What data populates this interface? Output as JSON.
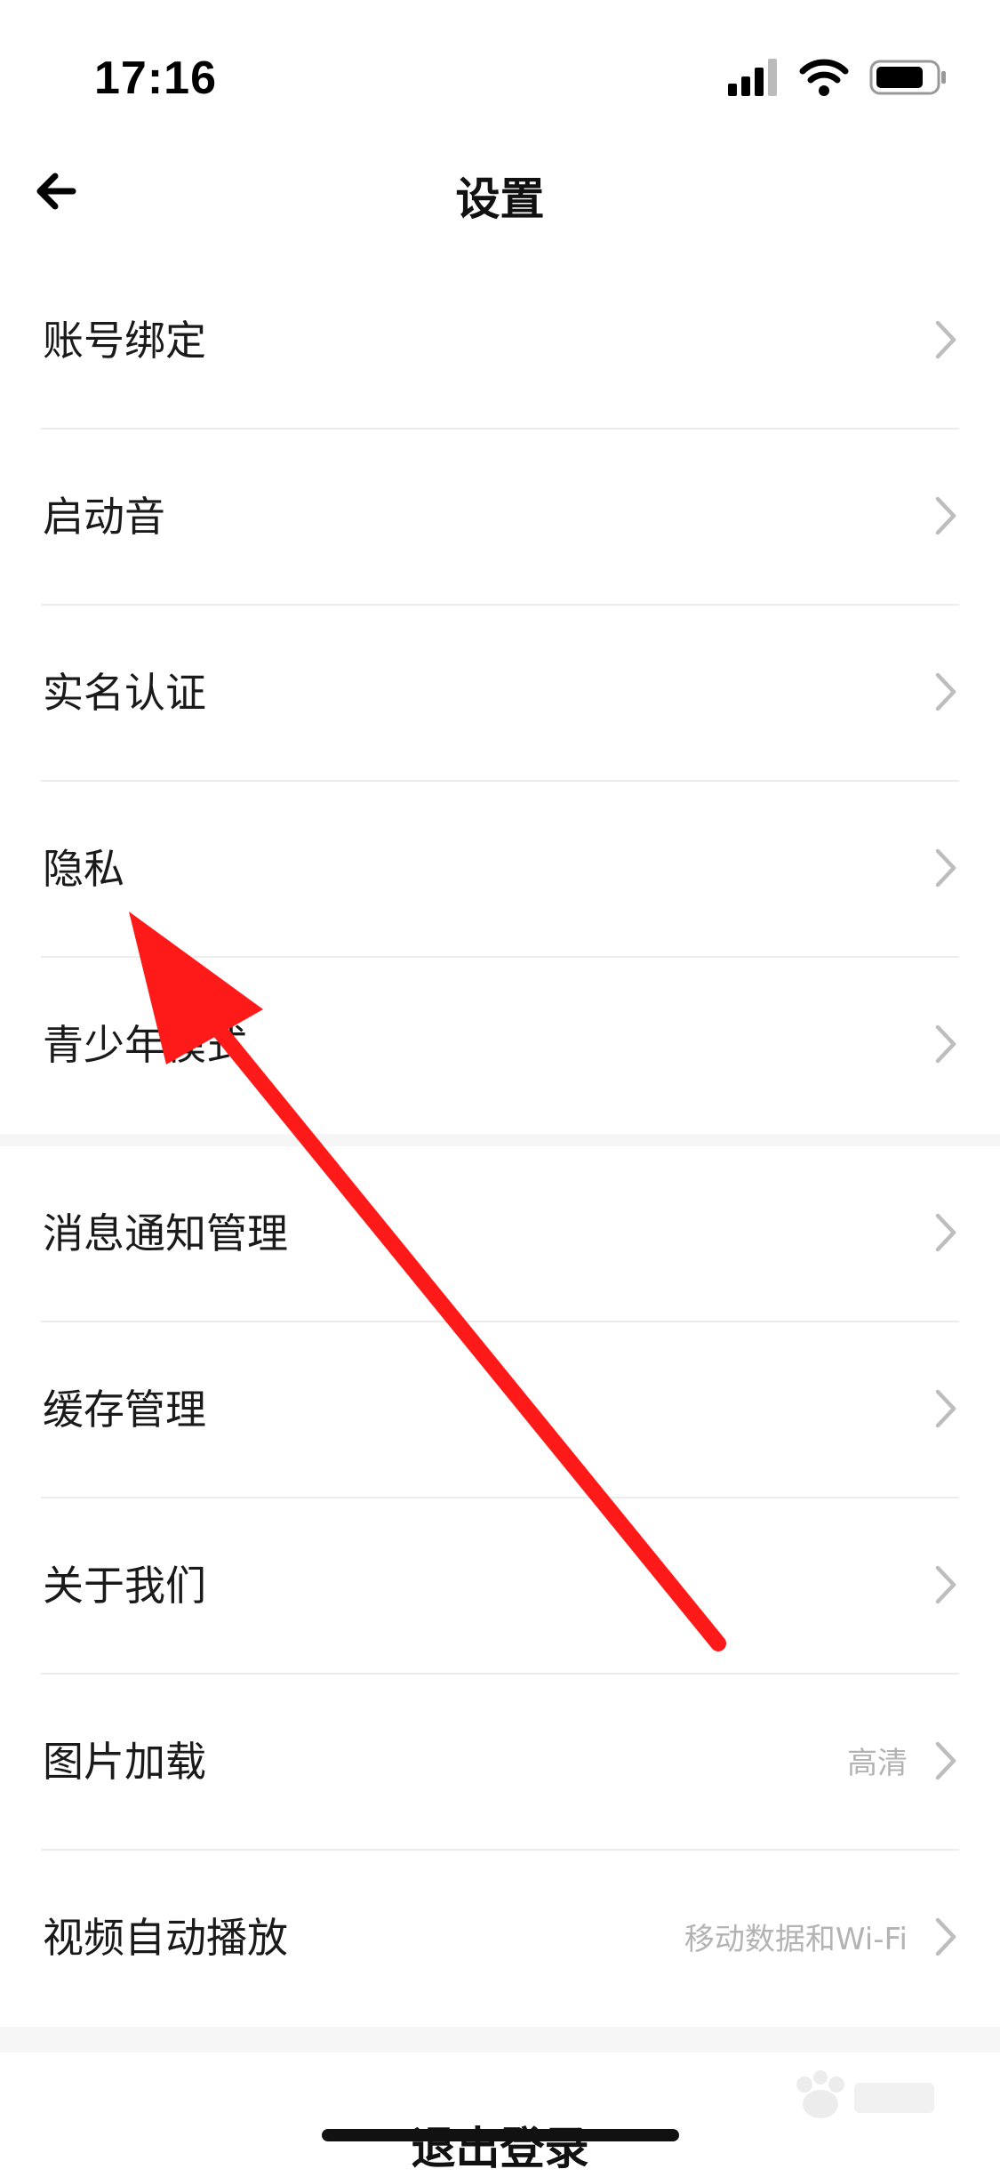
{
  "status_bar": {
    "time": "17:16"
  },
  "header": {
    "title": "设置",
    "back_icon": "arrow-left-icon"
  },
  "group1": [
    {
      "label": "账号绑定"
    },
    {
      "label": "启动音"
    },
    {
      "label": "实名认证"
    },
    {
      "label": "隐私"
    },
    {
      "label": "青少年模式"
    }
  ],
  "group2": [
    {
      "label": "消息通知管理",
      "value": ""
    },
    {
      "label": "缓存管理",
      "value": ""
    },
    {
      "label": "关于我们",
      "value": ""
    },
    {
      "label": "图片加载",
      "value": "高清"
    },
    {
      "label": "视频自动播放",
      "value": "移动数据和Wi-Fi"
    }
  ],
  "footer": {
    "logout_label": "退出登录"
  },
  "colors": {
    "arrow": "#ff1a1a",
    "divider": "#ececec",
    "secondary_text": "#b3b3b3"
  }
}
